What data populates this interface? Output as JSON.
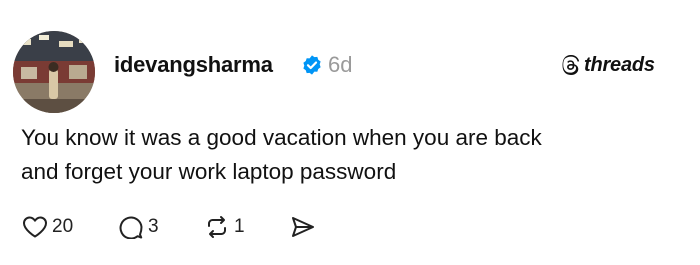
{
  "post": {
    "username": "idevangsharma",
    "age": "6d",
    "brand": "threads",
    "text_lines": [
      "You know it was a good vacation when you are back",
      "and forget your work laptop password"
    ],
    "stats": {
      "likes": "20",
      "replies": "3",
      "reposts": "1"
    }
  },
  "colors": {
    "verified": "#0095f6",
    "muted": "#9a9a9a",
    "text": "#111111"
  },
  "icons": {
    "verified": "verified-badge-icon",
    "brand": "threads-logo-icon",
    "like": "heart-icon",
    "reply": "comment-bubble-icon",
    "repost": "repost-icon",
    "share": "send-icon"
  }
}
